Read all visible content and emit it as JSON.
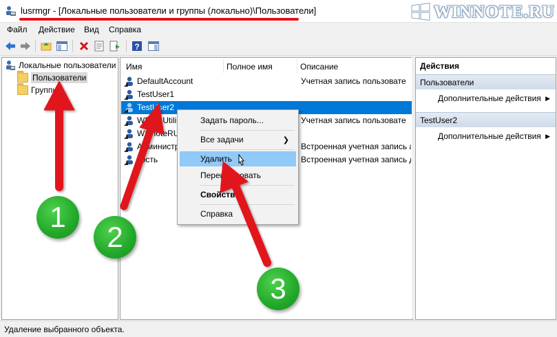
{
  "window": {
    "title": "lusrmgr - [Локальные пользователи и группы (локально)\\Пользователи]",
    "watermark": "WINNOTE.RU"
  },
  "menu": [
    "Файл",
    "Действие",
    "Вид",
    "Справка"
  ],
  "toolbar": {
    "icons": [
      "back-icon",
      "forward-icon",
      "up-folder-icon",
      "show-tree-icon",
      "delete-icon",
      "properties-icon",
      "export-icon",
      "help-icon",
      "action-pane-icon"
    ]
  },
  "tree": {
    "root": "Локальные пользователи",
    "items": [
      "Пользователи",
      "Группы"
    ]
  },
  "list": {
    "columns": [
      "Имя",
      "Полное имя",
      "Описание"
    ],
    "rows": [
      {
        "name": "DefaultAccount",
        "fullname": "",
        "description": "Учетная запись пользовате"
      },
      {
        "name": "TestUser1",
        "fullname": "",
        "description": ""
      },
      {
        "name": "TestUser2",
        "fullname": "",
        "description": ""
      },
      {
        "name": "WDAGUtili",
        "fullname": "",
        "description": "Учетная запись пользовате"
      },
      {
        "name": "WinnoteRU",
        "fullname": "",
        "description": ""
      },
      {
        "name": "Администр",
        "fullname": "",
        "description": "Встроенная учетная запись а"
      },
      {
        "name": "Гость",
        "fullname": "",
        "description": "Встроенная учетная запись д"
      }
    ]
  },
  "context_menu": {
    "items": [
      "Задать пароль...",
      "Все задачи",
      "Удалить",
      "Переименовать",
      "Свойства",
      "Справка"
    ]
  },
  "actions": {
    "header": "Действия",
    "section1": "Пользователи",
    "section1_item": "Дополнительные действия",
    "section2": "TestUser2",
    "section2_item": "Дополнительные действия"
  },
  "status": "Удаление выбранного объекта.",
  "annotations": [
    "1",
    "2",
    "3"
  ],
  "colors": {
    "selection": "#0078d7",
    "highlight": "#91c9f7",
    "arrow": "#e1141e",
    "badge": "#22a82a"
  }
}
